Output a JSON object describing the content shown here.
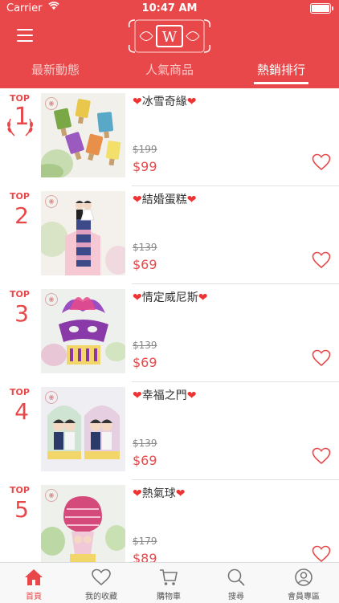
{
  "status_bar": {
    "carrier": "Carrier",
    "time": "10:47 AM"
  },
  "header": {
    "logo_letter": "W",
    "tabs": [
      {
        "label": "最新動態",
        "active": false
      },
      {
        "label": "人氣商品",
        "active": false
      },
      {
        "label": "熱銷排行",
        "active": true
      }
    ]
  },
  "ranking": {
    "top_label": "TOP",
    "items": [
      {
        "rank": "1",
        "name": "冰雪奇緣",
        "old_price": "$199",
        "price": "$99"
      },
      {
        "rank": "2",
        "name": "結婚蛋糕",
        "old_price": "$139",
        "price": "$69"
      },
      {
        "rank": "3",
        "name": "情定威尼斯",
        "old_price": "$139",
        "price": "$69"
      },
      {
        "rank": "4",
        "name": "幸福之門",
        "old_price": "$139",
        "price": "$69"
      },
      {
        "rank": "5",
        "name": "熱氣球",
        "old_price": "$179",
        "price": "$89"
      }
    ]
  },
  "bottom_nav": [
    {
      "label": "首頁",
      "icon": "home-icon",
      "active": true
    },
    {
      "label": "我的收藏",
      "icon": "heart-icon",
      "active": false
    },
    {
      "label": "購物車",
      "icon": "cart-icon",
      "active": false
    },
    {
      "label": "搜尋",
      "icon": "search-icon",
      "active": false
    },
    {
      "label": "會員專區",
      "icon": "user-icon",
      "active": false
    }
  ],
  "colors": {
    "brand": "#e8484a",
    "divider": "#e2e2e2",
    "nav_background": "#f8f8f8"
  }
}
